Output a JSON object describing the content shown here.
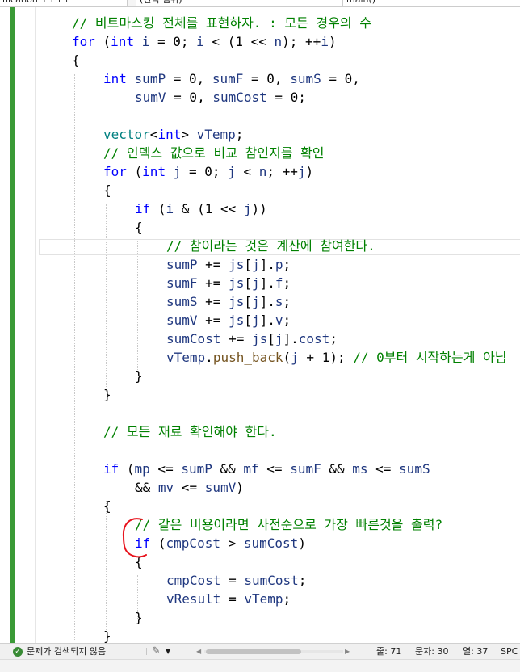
{
  "topbar": {
    "project_dropdown": "nication ↑↑↑↑",
    "scope_dropdown": "(전역 범위)",
    "member_dropdown": "main()"
  },
  "code": {
    "lines": [
      [
        [
          "cm",
          "// 비트마스킹 전체를 표현하자. : 모든 경우의 수"
        ]
      ],
      [
        [
          "kw",
          "for"
        ],
        [
          "tk",
          " ("
        ],
        [
          "kw",
          "int"
        ],
        [
          "tk",
          " "
        ],
        [
          "id",
          "i"
        ],
        [
          "tk",
          " = 0; "
        ],
        [
          "id",
          "i"
        ],
        [
          "tk",
          " < (1 << "
        ],
        [
          "id",
          "n"
        ],
        [
          "tk",
          "); ++"
        ],
        [
          "id",
          "i"
        ],
        [
          "tk",
          ")"
        ]
      ],
      [
        [
          "tk",
          "{"
        ]
      ],
      [
        [
          "kw",
          "int"
        ],
        [
          "tk",
          " "
        ],
        [
          "id",
          "sumP"
        ],
        [
          "tk",
          " = 0, "
        ],
        [
          "id",
          "sumF"
        ],
        [
          "tk",
          " = 0, "
        ],
        [
          "id",
          "sumS"
        ],
        [
          "tk",
          " = 0,"
        ]
      ],
      [
        [
          "id",
          "sumV"
        ],
        [
          "tk",
          " = 0, "
        ],
        [
          "id",
          "sumCost"
        ],
        [
          "tk",
          " = 0;"
        ]
      ],
      [],
      [
        [
          "op",
          "vector"
        ],
        [
          "tk",
          "<"
        ],
        [
          "kw",
          "int"
        ],
        [
          "tk",
          "> "
        ],
        [
          "id",
          "vTemp"
        ],
        [
          "tk",
          ";"
        ]
      ],
      [
        [
          "cm",
          "// 인덱스 값으로 비교 참인지를 확인"
        ]
      ],
      [
        [
          "kw",
          "for"
        ],
        [
          "tk",
          " ("
        ],
        [
          "kw",
          "int"
        ],
        [
          "tk",
          " "
        ],
        [
          "id",
          "j"
        ],
        [
          "tk",
          " = 0; "
        ],
        [
          "id",
          "j"
        ],
        [
          "tk",
          " < "
        ],
        [
          "id",
          "n"
        ],
        [
          "tk",
          "; ++"
        ],
        [
          "id",
          "j"
        ],
        [
          "tk",
          ")"
        ]
      ],
      [
        [
          "tk",
          "{"
        ]
      ],
      [
        [
          "kw",
          "if"
        ],
        [
          "tk",
          " ("
        ],
        [
          "id",
          "i"
        ],
        [
          "tk",
          " & (1 << "
        ],
        [
          "id",
          "j"
        ],
        [
          "tk",
          "))"
        ]
      ],
      [
        [
          "tk",
          "{"
        ]
      ],
      [
        [
          "cm",
          "// 참이라는 것은 계산에 참여한다."
        ]
      ],
      [
        [
          "id",
          "sumP"
        ],
        [
          "tk",
          " += "
        ],
        [
          "id",
          "js"
        ],
        [
          "tk",
          "["
        ],
        [
          "id",
          "j"
        ],
        [
          "tk",
          "]."
        ],
        [
          "id",
          "p"
        ],
        [
          "tk",
          ";"
        ]
      ],
      [
        [
          "id",
          "sumF"
        ],
        [
          "tk",
          " += "
        ],
        [
          "id",
          "js"
        ],
        [
          "tk",
          "["
        ],
        [
          "id",
          "j"
        ],
        [
          "tk",
          "]."
        ],
        [
          "id",
          "f"
        ],
        [
          "tk",
          ";"
        ]
      ],
      [
        [
          "id",
          "sumS"
        ],
        [
          "tk",
          " += "
        ],
        [
          "id",
          "js"
        ],
        [
          "tk",
          "["
        ],
        [
          "id",
          "j"
        ],
        [
          "tk",
          "]."
        ],
        [
          "id",
          "s"
        ],
        [
          "tk",
          ";"
        ]
      ],
      [
        [
          "id",
          "sumV"
        ],
        [
          "tk",
          " += "
        ],
        [
          "id",
          "js"
        ],
        [
          "tk",
          "["
        ],
        [
          "id",
          "j"
        ],
        [
          "tk",
          "]."
        ],
        [
          "id",
          "v"
        ],
        [
          "tk",
          ";"
        ]
      ],
      [
        [
          "id",
          "sumCost"
        ],
        [
          "tk",
          " += "
        ],
        [
          "id",
          "js"
        ],
        [
          "tk",
          "["
        ],
        [
          "id",
          "j"
        ],
        [
          "tk",
          "]."
        ],
        [
          "id",
          "cost"
        ],
        [
          "tk",
          ";"
        ]
      ],
      [
        [
          "id",
          "vTemp"
        ],
        [
          "tk",
          "."
        ],
        [
          "fn",
          "push_back"
        ],
        [
          "tk",
          "("
        ],
        [
          "id",
          "j"
        ],
        [
          "tk",
          " + 1); "
        ],
        [
          "cm",
          "// 0부터 시작하는게 아님"
        ]
      ],
      [
        [
          "tk",
          "}"
        ]
      ],
      [
        [
          "tk",
          "}"
        ]
      ],
      [],
      [
        [
          "cm",
          "// 모든 재료 확인해야 한다."
        ]
      ],
      [],
      [
        [
          "kw",
          "if"
        ],
        [
          "tk",
          " ("
        ],
        [
          "id",
          "mp"
        ],
        [
          "tk",
          " <= "
        ],
        [
          "id",
          "sumP"
        ],
        [
          "tk",
          " && "
        ],
        [
          "id",
          "mf"
        ],
        [
          "tk",
          " <= "
        ],
        [
          "id",
          "sumF"
        ],
        [
          "tk",
          " && "
        ],
        [
          "id",
          "ms"
        ],
        [
          "tk",
          " <= "
        ],
        [
          "id",
          "sumS"
        ]
      ],
      [
        [
          "tk",
          "&& "
        ],
        [
          "id",
          "mv"
        ],
        [
          "tk",
          " <= "
        ],
        [
          "id",
          "sumV"
        ],
        [
          "tk",
          ")"
        ]
      ],
      [
        [
          "tk",
          "{"
        ]
      ],
      [
        [
          "cm",
          "// 같은 비용이라면 사전순으로 가장 빠른것을 출력?"
        ]
      ],
      [
        [
          "kw",
          "if"
        ],
        [
          "tk",
          " ("
        ],
        [
          "id",
          "cmpCost"
        ],
        [
          "tk",
          " > "
        ],
        [
          "id",
          "sumCost"
        ],
        [
          "tk",
          ")"
        ]
      ],
      [
        [
          "tk",
          "{"
        ]
      ],
      [
        [
          "id",
          "cmpCost"
        ],
        [
          "tk",
          " = "
        ],
        [
          "id",
          "sumCost"
        ],
        [
          "tk",
          ";"
        ]
      ],
      [
        [
          "id",
          "vResult"
        ],
        [
          "tk",
          " = "
        ],
        [
          "id",
          "vTemp"
        ],
        [
          "tk",
          ";"
        ]
      ],
      [
        [
          "tk",
          "}"
        ]
      ],
      [
        [
          "tk",
          "}"
        ]
      ]
    ]
  },
  "status": {
    "issues": "문제가 검색되지 않음",
    "line": "줄: 71",
    "char": "문자: 30",
    "col": "열: 37",
    "mode": "SPC"
  },
  "colors": {
    "keyword": "#0000ff",
    "comment": "#008000",
    "identifier": "#1f377f",
    "function": "#74531f",
    "type": "#008080",
    "change_bar": "#3a9a36",
    "annotation": "#e8141e"
  },
  "icons": [
    "check-circle-icon",
    "brush-icon",
    "chevron-down-icon",
    "scroll-left-icon",
    "scroll-right-icon"
  ]
}
